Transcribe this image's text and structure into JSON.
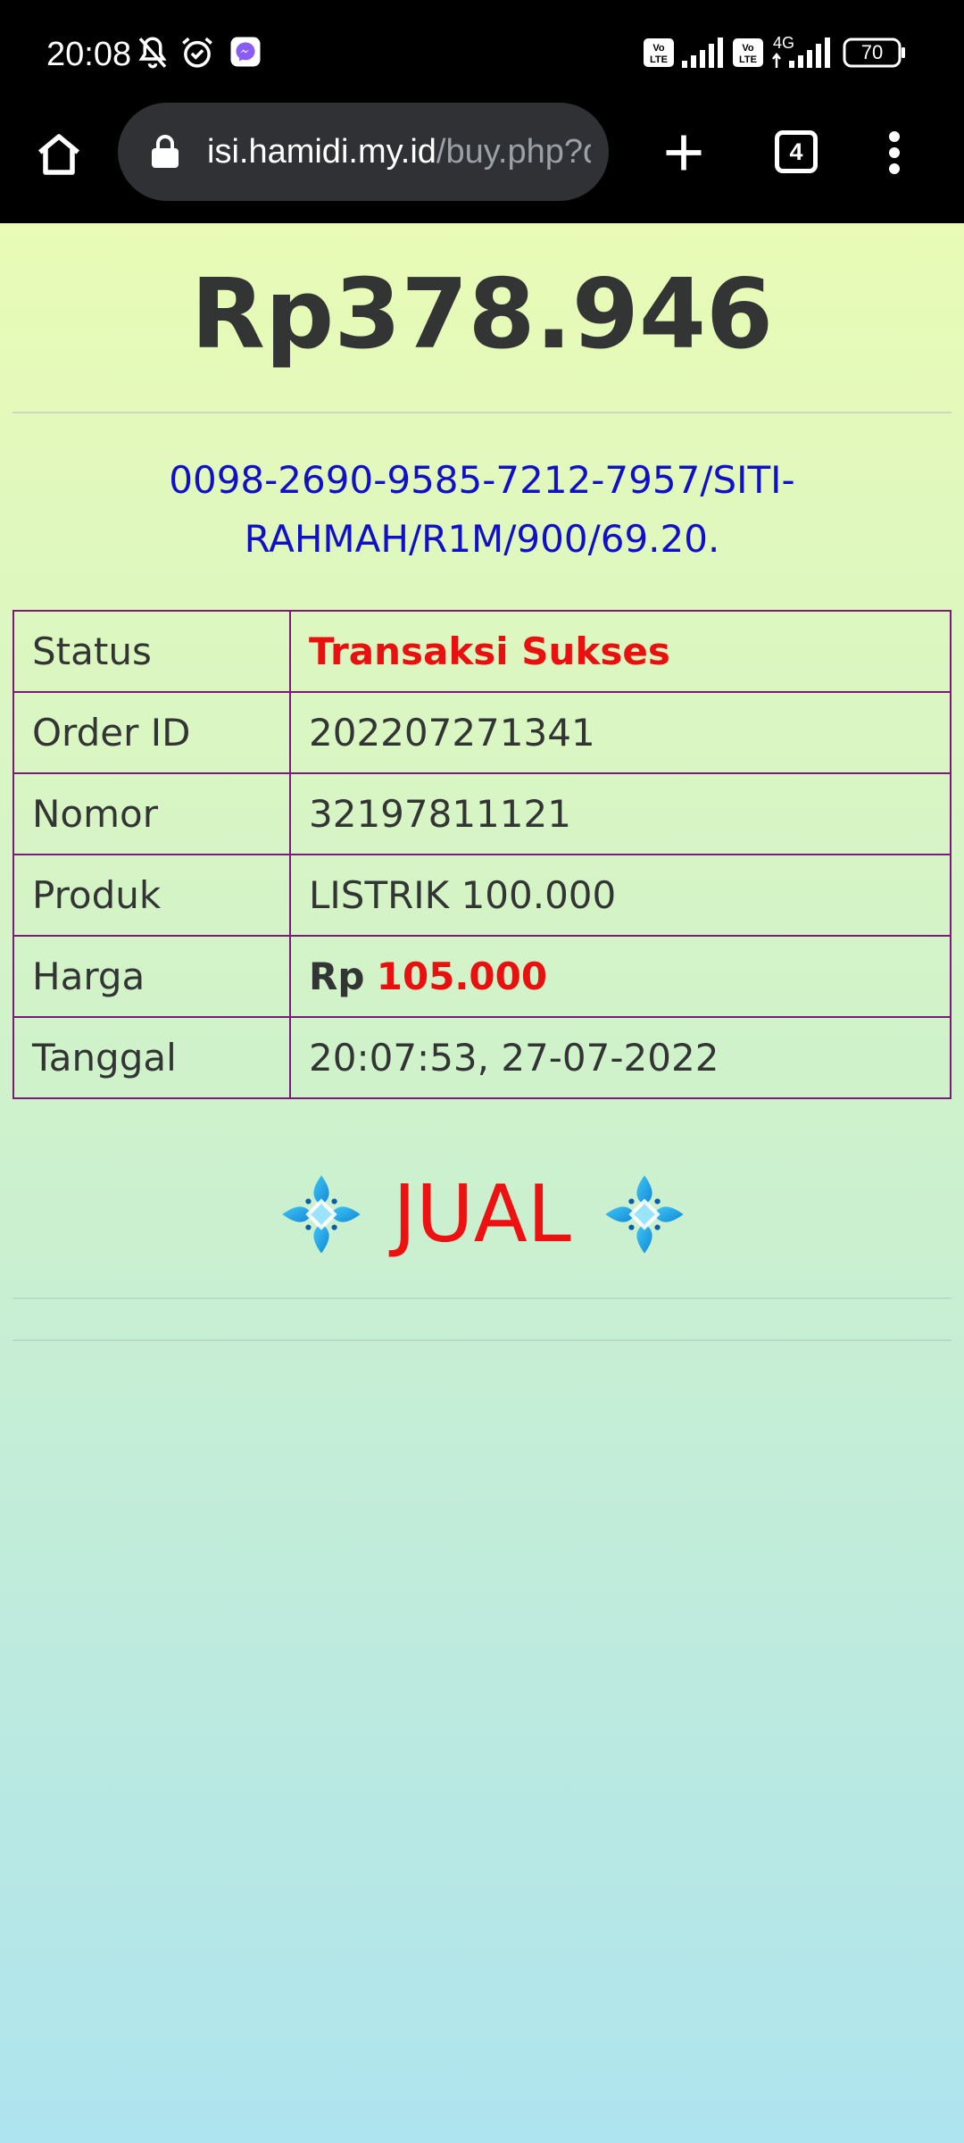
{
  "status_bar": {
    "time": "20:08",
    "icons": [
      "bell-off-icon",
      "alarm-icon",
      "messenger-icon",
      "volte-icon",
      "signal-icon",
      "volte-icon",
      "4g-signal-icon",
      "battery-icon"
    ],
    "network_label": "4G",
    "volte_label": "Vo LTE",
    "battery_level": "70"
  },
  "browser": {
    "url_host": "isi.hamidi.my.id",
    "url_path": "/buy.php?d",
    "tab_count": "4",
    "icons": [
      "home-icon",
      "lock-icon",
      "new-tab-icon",
      "tabs-icon",
      "more-vert-icon"
    ]
  },
  "page": {
    "balance": "Rp378.946",
    "token": "0098-2690-9585-7212-7957/SITI-RAHMAH/R1M/900/69.20.",
    "rows": [
      {
        "label": "Status",
        "value": "Transaksi Sukses"
      },
      {
        "label": "Order ID",
        "value": "202207271341"
      },
      {
        "label": "Nomor",
        "value": "32197811121"
      },
      {
        "label": "Produk",
        "value": "LISTRIK 100.000"
      },
      {
        "label": "Harga",
        "currency": "Rp",
        "value": "105.000"
      },
      {
        "label": "Tanggal",
        "value": "20:07:53, 27-07-2022"
      }
    ],
    "action_label": "JUAL",
    "colors": {
      "success": "#e8110f",
      "token": "#1010c8",
      "table_border": "#7b1a7b",
      "background_top": "#e9fbb6",
      "background_bottom": "#aee4ef"
    }
  }
}
